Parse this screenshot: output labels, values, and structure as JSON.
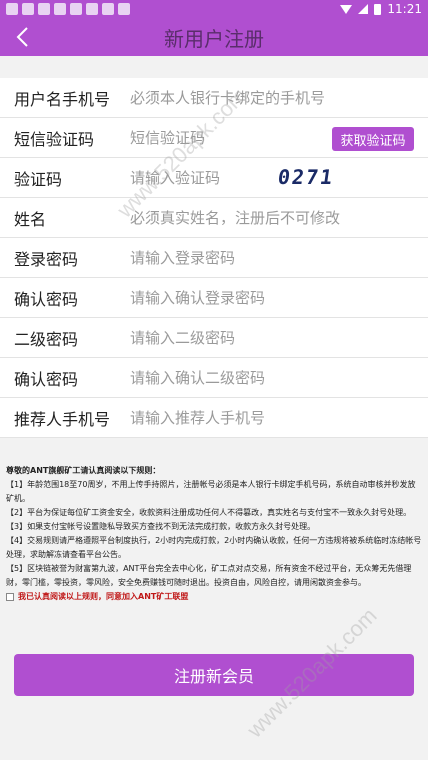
{
  "status": {
    "time": "11:21"
  },
  "header": {
    "title": "新用户注册"
  },
  "form": {
    "rows": [
      {
        "label": "用户名手机号",
        "placeholder": "必须本人银行卡绑定的手机号"
      },
      {
        "label": "短信验证码",
        "placeholder": "短信验证码",
        "button": "获取验证码"
      },
      {
        "label": "验证码",
        "placeholder": "请输入验证码",
        "captcha": "0271"
      },
      {
        "label": "姓名",
        "placeholder": "必须真实姓名，注册后不可修改"
      },
      {
        "label": "登录密码",
        "placeholder": "请输入登录密码"
      },
      {
        "label": "确认密码",
        "placeholder": "请输入确认登录密码"
      },
      {
        "label": "二级密码",
        "placeholder": "请输入二级密码"
      },
      {
        "label": "确认密码",
        "placeholder": "请输入确认二级密码"
      },
      {
        "label": "推荐人手机号",
        "placeholder": "请输入推荐人手机号"
      }
    ]
  },
  "rules": {
    "title": "尊敬的ANT旗舰矿工请认真阅读以下规则：",
    "items": [
      "【1】年龄范围18至70周岁，不用上传手持照片，注册帐号必须是本人银行卡绑定手机号码，系统自动审核并秒发放矿机。",
      "【2】平台为保证每位矿工资金安全，收款资料注册成功任何人不得篡改，真实姓名与支付宝不一致永久封号处理。",
      "【3】如果支付宝帐号设置隐私导致买方查找不到无法完成打款，收款方永久封号处理。",
      "【4】交易规则请严格遵照平台制度执行，2小时内完成打款，2小时内确认收款，任何一方违规将被系统临时冻结帐号处理，求助解冻请查看平台公告。",
      "【5】区块链被誉为财富第九波，ANT平台完全去中心化，矿工点对点交易，所有资金不经过平台，无众筹无先借理财，零门槛，零投资，零风险，安全免费赚钱可随时退出。投资自由，风险自控，请用闲散资金参与。"
    ],
    "agree": "我已认真阅读以上规则，同意加入ANT矿工联盟"
  },
  "submit": {
    "label": "注册新会员"
  },
  "watermark": "www.520apk.com"
}
